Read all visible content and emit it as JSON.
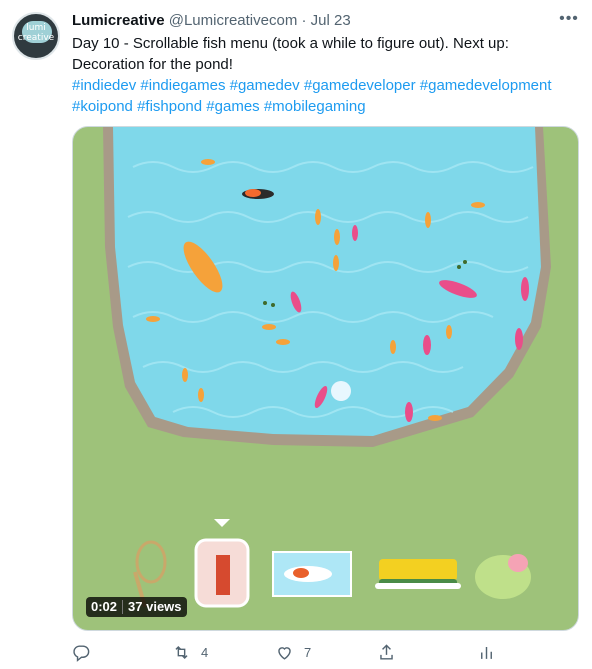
{
  "tweet": {
    "author_name": "Lumicreative",
    "author_handle": "@Lumicreativecom",
    "separator": "·",
    "date": "Jul 23",
    "avatar_text": "lumi creative",
    "text_lines": [
      "Day 10 - Scrollable fish menu (took a while to figure out). Next up:",
      "Decoration for the pond!"
    ],
    "hashtags_line1": [
      "#indiedev",
      "#indiegames",
      "#gamedev",
      "#gamedeveloper",
      "#gamedevelopment"
    ],
    "hashtags_line2": [
      "#koipond",
      "#fishpond",
      "#games",
      "#mobilegaming"
    ]
  },
  "video": {
    "duration": "0:02",
    "views": "37 views",
    "menu_items": [
      "fishing-net",
      "koi-bag",
      "koi-tank",
      "sponge",
      "lily-pad"
    ],
    "selected_menu_item": "koi-bag"
  },
  "actions": {
    "replies": "",
    "retweets": "4",
    "likes": "7",
    "share": "",
    "analytics": ""
  },
  "colors": {
    "link": "#1d9bf0",
    "muted": "#536471",
    "grass": "#9ec27a",
    "water": "#7fd8ea",
    "stone": "#a89a88"
  },
  "icons": {
    "more": "more-dots-icon",
    "reply": "reply-icon",
    "retweet": "retweet-icon",
    "like": "heart-icon",
    "share": "share-icon",
    "analytics": "analytics-icon"
  }
}
